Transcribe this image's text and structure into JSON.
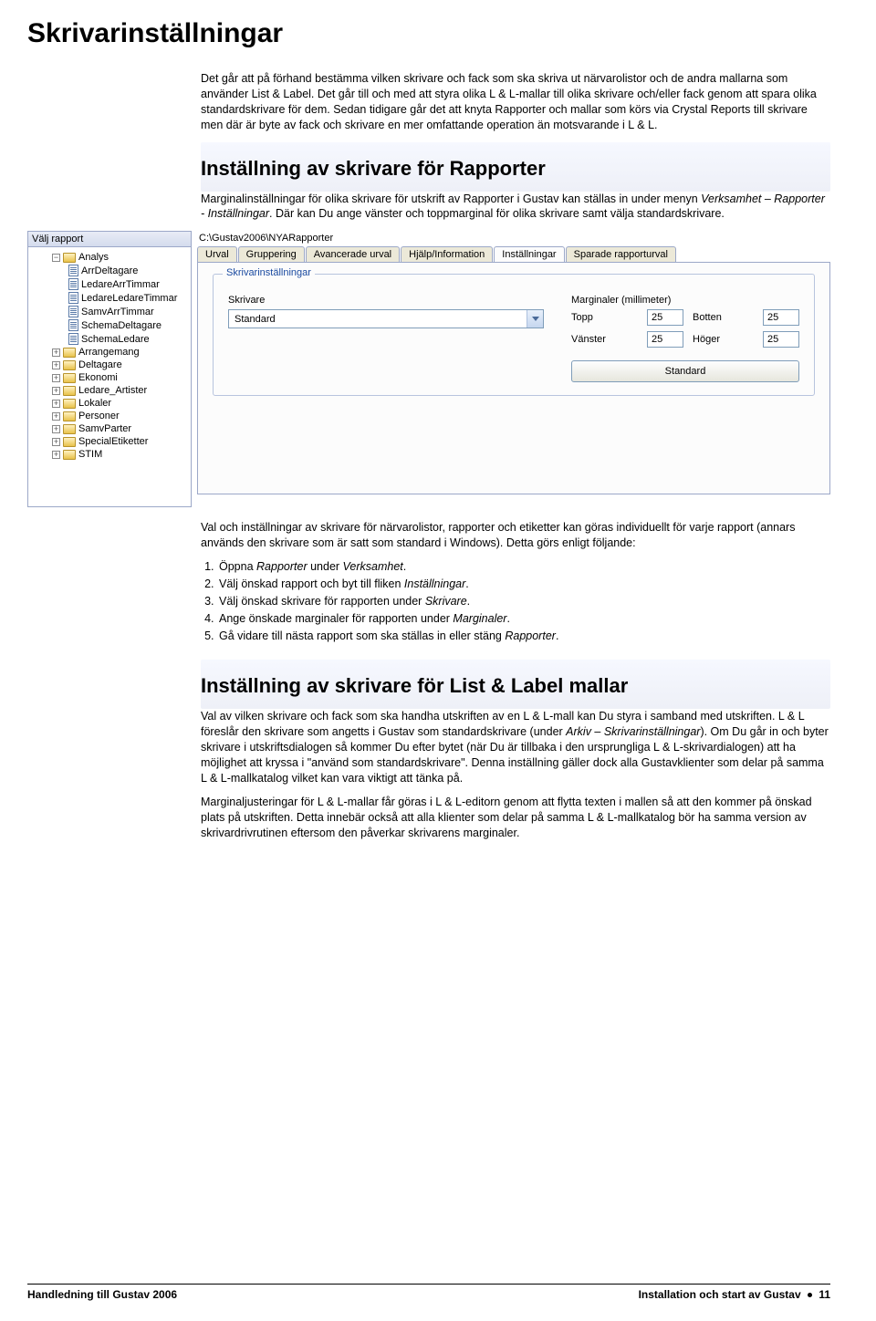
{
  "h1": "Skrivarinställningar",
  "intro": "Det går att på förhand bestämma vilken skrivare och fack som ska skriva ut närvarolistor och de andra mallarna som använder List & Label. Det går till och med att styra olika L & L-mallar till olika skrivare och/eller fack genom att spara olika standardskrivare för dem. Sedan tidigare går det att knyta Rapporter och mallar som körs via Crystal Reports till skrivare men där är byte av fack och skrivare en mer omfattande operation än motsvarande i L & L.",
  "sec1_h": "Inställning av skrivare för Rapporter",
  "sec1_p": "Marginalinställningar för olika skrivare för utskrift av Rapporter i Gustav kan ställas in under menyn Verksamhet – Rapporter - Inställningar. Där kan Du ange vänster och toppmarginal för olika skrivare samt välja standardskrivare.",
  "tree_title": "Välj rapport",
  "path": "C:\\Gustav2006\\NYARapporter",
  "tree": {
    "analysis": "Analys",
    "items": [
      "ArrDeltagare",
      "LedareArrTimmar",
      "LedareLedareTimmar",
      "SamvArrTimmar",
      "SchemaDeltagare",
      "SchemaLedare"
    ],
    "folders": [
      "Arrangemang",
      "Deltagare",
      "Ekonomi",
      "Ledare_Artister",
      "Lokaler",
      "Personer",
      "SamvParter",
      "SpecialEtiketter",
      "STIM"
    ]
  },
  "tabs": [
    "Urval",
    "Gruppering",
    "Avancerade urval",
    "Hjälp/Information",
    "Inställningar",
    "Sparade rapporturval"
  ],
  "settings": {
    "legend": "Skrivarinställningar",
    "printerLabel": "Skrivare",
    "printerValue": "Standard",
    "marginsLabel": "Marginaler (millimeter)",
    "topp": "Topp",
    "botten": "Botten",
    "vanster": "Vänster",
    "hoger": "Höger",
    "v_topp": "25",
    "v_botten": "25",
    "v_vanster": "25",
    "v_hoger": "25",
    "stdBtn": "Standard"
  },
  "mid_p": "Val och inställningar av skrivare för närvarolistor, rapporter och etiketter kan göras individuellt för varje rapport (annars används den skrivare som är satt som standard i Windows). Detta görs enligt följande:",
  "steps": [
    {
      "pre": "Öppna ",
      "i": "Rapporter",
      "mid": " under ",
      "i2": "Verksamhet",
      "post": "."
    },
    {
      "pre": "Välj önskad rapport och byt till fliken ",
      "i": "Inställningar",
      "post": "."
    },
    {
      "pre": "Välj önskad skrivare för rapporten under ",
      "i": "Skrivare",
      "post": "."
    },
    {
      "pre": "Ange önskade marginaler för rapporten under ",
      "i": "Marginaler",
      "post": "."
    },
    {
      "pre": "Gå vidare till nästa rapport som ska ställas in eller stäng ",
      "i": "Rapporter",
      "post": "."
    }
  ],
  "sec2_h": "Inställning av skrivare för List & Label mallar",
  "sec2_p1a": "Val av vilken skrivare och fack som ska handha utskriften av en L & L-mall kan Du styra i samband med utskriften. L & L föreslår den skrivare som angetts i Gustav som standardskrivare (under ",
  "sec2_p1i": "Arkiv – Skrivarinställningar",
  "sec2_p1b": "). Om Du går in och byter skrivare i utskriftsdialogen så kommer Du efter bytet (när Du är tillbaka i den ursprungliga L & L-skrivardialogen) att ha möjlighet att kryssa i \"använd som standardskrivare\". Denna inställning gäller dock alla Gustavklienter som delar på samma L & L-mallkatalog vilket kan vara viktigt att tänka på.",
  "sec2_p2": "Marginaljusteringar för L & L-mallar får göras i L & L-editorn genom att flytta texten i mallen så att den kommer på önskad plats på utskriften. Detta innebär också att alla klienter som delar på samma L & L-mallkatalog bör ha samma version av skrivardrivrutinen eftersom den påverkar skrivarens marginaler.",
  "footer_left": "Handledning till Gustav 2006",
  "footer_right_a": "Installation och start av Gustav",
  "footer_right_b": "11"
}
